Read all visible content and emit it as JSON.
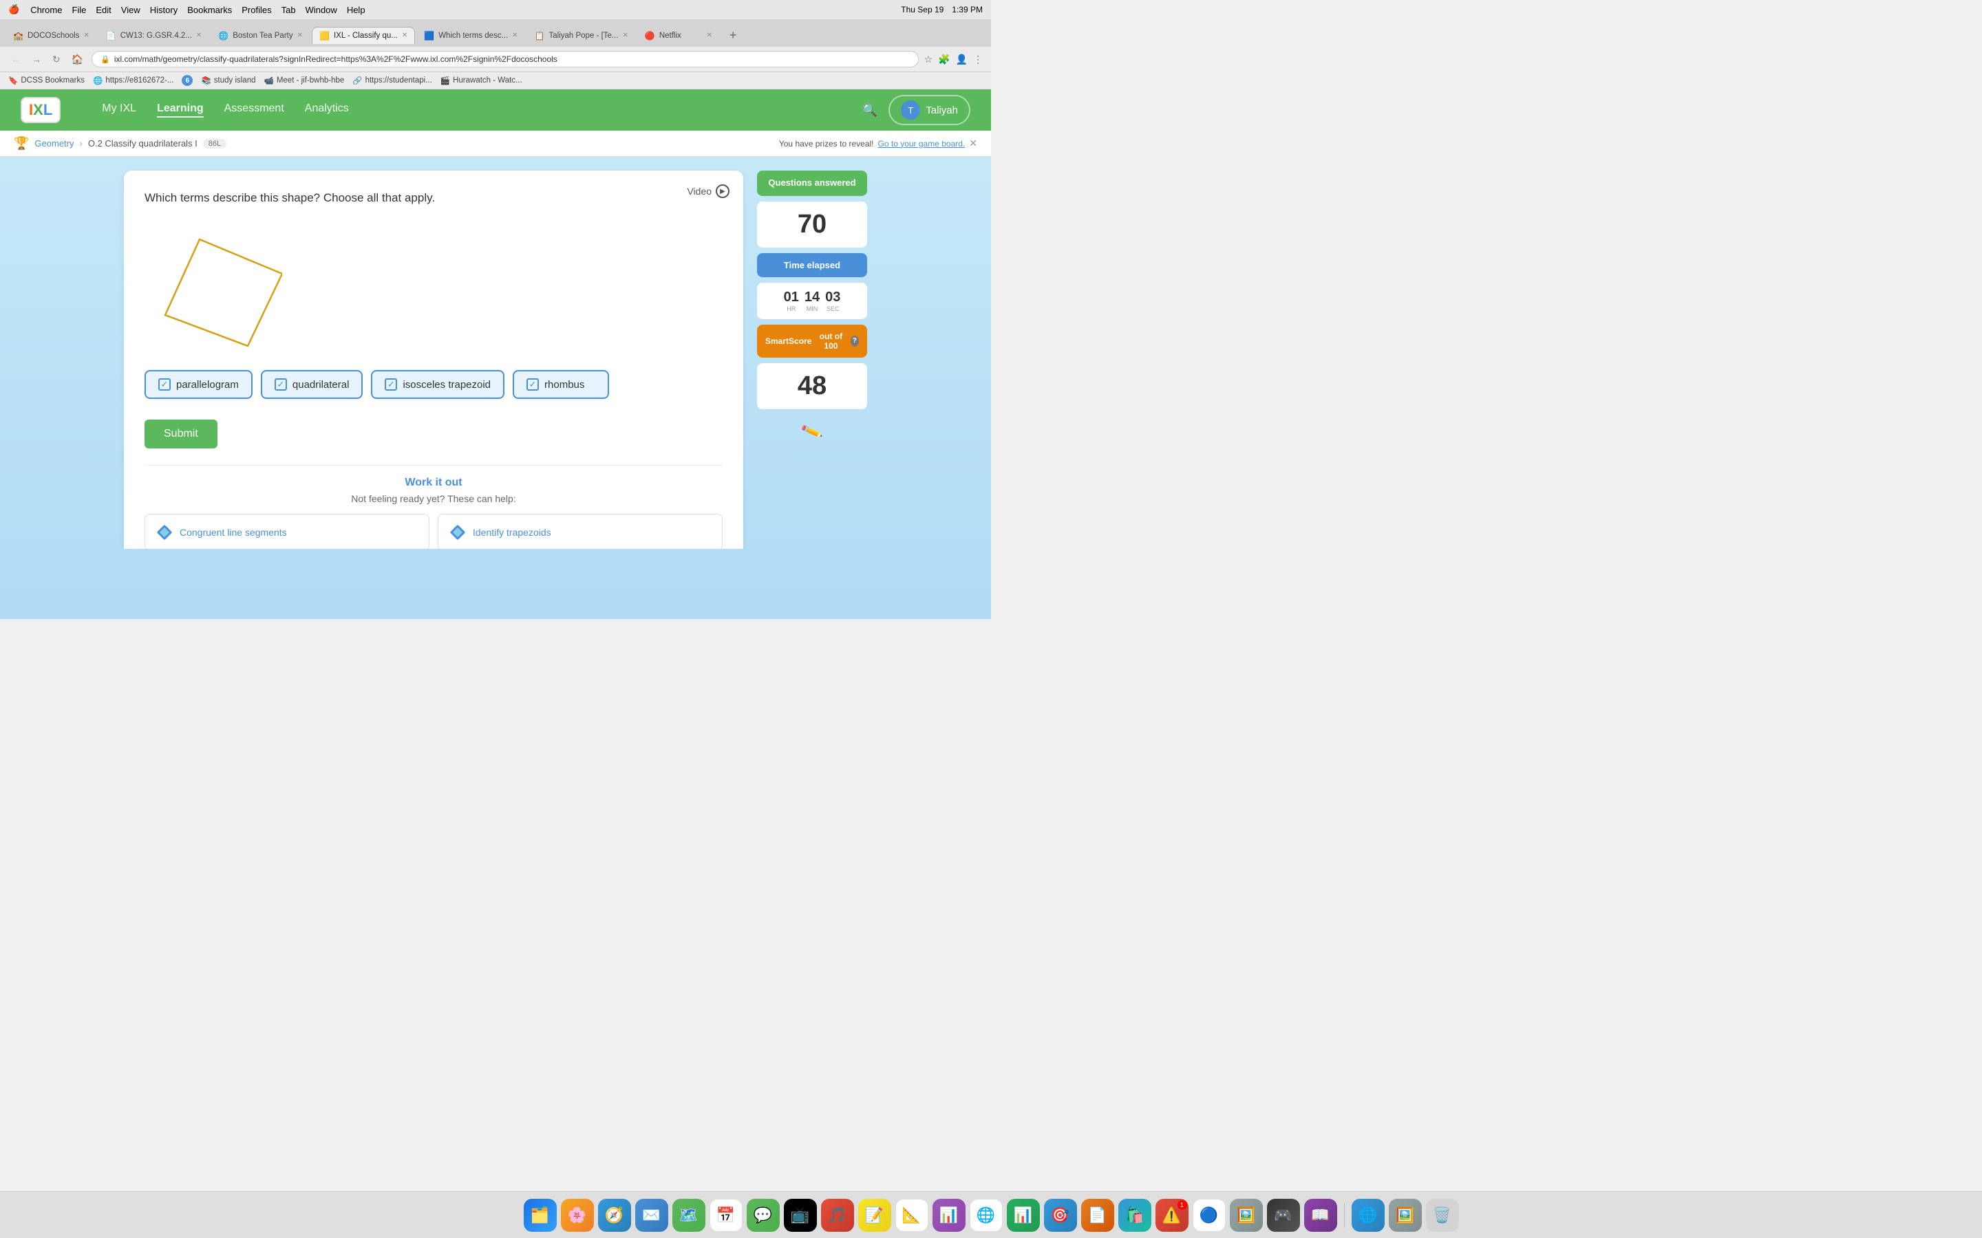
{
  "menubar": {
    "apple": "🍎",
    "items": [
      "Chrome",
      "File",
      "Edit",
      "View",
      "History",
      "Bookmarks",
      "Profiles",
      "Tab",
      "Window",
      "Help"
    ],
    "right": {
      "date": "Thu Sep 19",
      "time": "1:39 PM"
    }
  },
  "tabs": [
    {
      "id": "tab-doco",
      "label": "DOCOSchools",
      "icon": "🏫",
      "active": false,
      "closable": true
    },
    {
      "id": "tab-cw13",
      "label": "CW13: G.GSR.4.2...",
      "icon": "📄",
      "active": false,
      "closable": true
    },
    {
      "id": "tab-boston",
      "label": "Boston Tea Party",
      "icon": "🌐",
      "active": false,
      "closable": true
    },
    {
      "id": "tab-ixl",
      "label": "IXL - Classify qu...",
      "icon": "🟨",
      "active": true,
      "closable": true
    },
    {
      "id": "tab-which",
      "label": "Which terms desc...",
      "icon": "🟦",
      "active": false,
      "closable": true
    },
    {
      "id": "tab-taliyah",
      "label": "Taliyah Pope - [Te...",
      "icon": "📋",
      "active": false,
      "closable": true
    },
    {
      "id": "tab-netflix",
      "label": "Netflix",
      "icon": "🔴",
      "active": false,
      "closable": true
    }
  ],
  "addressbar": {
    "url": "ixl.com/math/geometry/classify-quadrilaterals?signInRedirect=https%3A%2F%2Fwww.ixl.com%2Fsignin%2Fdocoschools"
  },
  "bookmarks": [
    {
      "id": "bm-dcss",
      "label": "DCSS Bookmarks",
      "icon": "🔖"
    },
    {
      "id": "bm-e816",
      "label": "https://e8162672-...",
      "icon": "🌐"
    },
    {
      "id": "bm-6",
      "label": "6",
      "icon": "🔵"
    },
    {
      "id": "bm-study",
      "label": "study island",
      "icon": "📚"
    },
    {
      "id": "bm-meet",
      "label": "Meet - jif-bwhb-hbe",
      "icon": "📹"
    },
    {
      "id": "bm-studentapi",
      "label": "https://studentapi...",
      "icon": "🔗"
    },
    {
      "id": "bm-hurawatch",
      "label": "Hurawatch - Watc...",
      "icon": "🎬"
    }
  ],
  "ixl": {
    "logo_text": "IXL",
    "nav": [
      "My IXL",
      "Learning",
      "Assessment",
      "Analytics"
    ],
    "user": "Taliyah",
    "breadcrumb": {
      "parent": "Geometry",
      "current": "O.2 Classify quadrilaterals I",
      "level": "86L"
    },
    "prize_notice": {
      "text": "You have prizes to reveal!",
      "link": "Go to your game board."
    }
  },
  "exercise": {
    "question": "Which terms describe this shape? Choose all that apply.",
    "video_label": "Video",
    "choices": [
      {
        "id": "parallelogram",
        "label": "parallelogram",
        "checked": true
      },
      {
        "id": "quadrilateral",
        "label": "quadrilateral",
        "checked": true
      },
      {
        "id": "isosceles-trapezoid",
        "label": "isosceles trapezoid",
        "checked": true
      },
      {
        "id": "rhombus",
        "label": "rhombus",
        "checked": true
      }
    ],
    "submit_label": "Submit",
    "work_it_out": {
      "title": "Work it out",
      "subtitle": "Not feeling ready yet? These can help:",
      "resources": [
        {
          "id": "congruent",
          "label": "Congruent line segments"
        },
        {
          "id": "trapezoids",
          "label": "Identify trapezoids"
        }
      ]
    }
  },
  "sidebar": {
    "questions_answered": {
      "label": "Questions answered",
      "count": "70"
    },
    "time_elapsed": {
      "label": "Time elapsed",
      "hr": "01",
      "min": "14",
      "sec": "03",
      "hr_label": "HR",
      "min_label": "MIN",
      "sec_label": "SEC"
    },
    "smart_score": {
      "label": "SmartScore",
      "out_of": "out of 100",
      "value": "48"
    }
  },
  "colors": {
    "green": "#5cb85c",
    "blue": "#4a90d9",
    "orange": "#e8830a",
    "light_blue_bg": "#b8dff5"
  }
}
